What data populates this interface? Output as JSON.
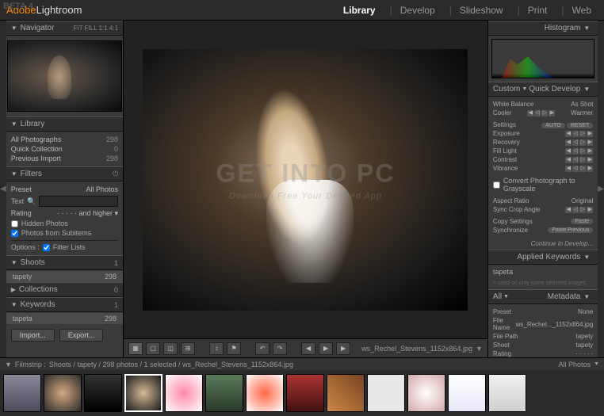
{
  "app": {
    "beta": "BETA 4",
    "brand1": "Adobe",
    "brand2": "Lightroom"
  },
  "modules": [
    "Library",
    "Develop",
    "Slideshow",
    "Print",
    "Web"
  ],
  "active_module": "Library",
  "navigator": {
    "title": "Navigator",
    "modes": "FIT  FILL  1:1  4:1"
  },
  "library": {
    "title": "Library",
    "items": [
      {
        "label": "All Photographs",
        "count": "298"
      },
      {
        "label": "Quick Collection",
        "count": "0"
      },
      {
        "label": "Previous Import",
        "count": "298"
      }
    ]
  },
  "filters": {
    "title": "Filters",
    "preset_label": "Preset",
    "preset_value": "All Photos",
    "text_label": "Text",
    "search_icon": "🔍",
    "rating_label": "Rating",
    "rating_rule": "and higher",
    "hidden": "Hidden Photos",
    "subitems": "Photos from Subitems",
    "options_label": "Options :",
    "filter_lists": "Filter Lists"
  },
  "shoots": {
    "title": "Shoots",
    "count": "1",
    "item": "tapety",
    "item_count": "298"
  },
  "collections": {
    "title": "Collections",
    "count": "0"
  },
  "keywords": {
    "title": "Keywords",
    "count": "1",
    "item": "tapeta",
    "item_count": "298"
  },
  "buttons": {
    "import": "Import...",
    "export": "Export..."
  },
  "watermark": {
    "main": "GET INTO PC",
    "sub": "Download Free Your Desired App"
  },
  "toolbar_file": "ws_Rechel_Stevens_1152x864.jpg",
  "histogram": {
    "title": "Histogram"
  },
  "quick_develop": {
    "title": "Quick Develop",
    "custom": "Custom",
    "wb_label": "White Balance",
    "wb_value": "As Shot",
    "cooler": "Cooler",
    "warmer": "Warmer",
    "settings": "Settings",
    "auto": "AUTO",
    "reset": "RESET",
    "exposure": "Exposure",
    "recovery": "Recovery",
    "fill": "Fill Light",
    "contrast": "Contrast",
    "vibrance": "Vibrance",
    "grayscale": "Convert Photograph to Grayscale",
    "aspect": "Aspect Ratio",
    "aspect_val": "Original",
    "sync_crop": "Sync Crop Angle",
    "copy": "Copy Settings",
    "paste": "Paste",
    "sync": "Synchronize",
    "paste_prev": "Paste Previous",
    "continue": "Continue in Develop..."
  },
  "applied_kw": {
    "title": "Applied Keywords",
    "value": "tapeta",
    "hint": "< used on only some selected images"
  },
  "metadata": {
    "title": "Metadata",
    "all": "All",
    "preset_label": "Preset",
    "preset_val": "None",
    "filename_label": "File Name",
    "filename_val": "ws_Rechel..._1152x864.jpg",
    "filepath_label": "File Path",
    "filepath_val": "tapety",
    "shoot_label": "Shoot",
    "shoot_val": "tapety",
    "rating_label": "Rating"
  },
  "filmstrip": {
    "label": "Filmstrip :",
    "path": "Shoots / tapety / 298 photos / 1 selected / ws_Rechel_Stevens_1152x864.jpg",
    "all": "All Photos"
  }
}
